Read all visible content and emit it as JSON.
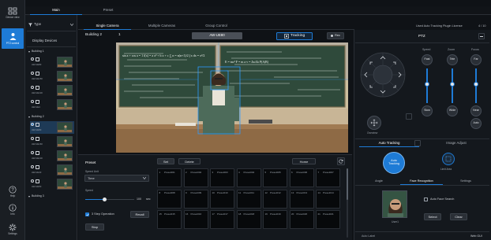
{
  "colors": {
    "accent": "#1e7bd6",
    "bg": "#0f1216",
    "panel": "#14181d",
    "panel2": "#1b2027",
    "text": "#cfd3d9"
  },
  "left_rail": {
    "items": [
      {
        "label": "Device view",
        "icon": "camera-list-icon"
      },
      {
        "label": "PTZ control",
        "icon": "person-tracking-icon",
        "active": true
      }
    ],
    "bottom": [
      {
        "label": "Help",
        "icon": "help-icon"
      },
      {
        "label": "Info",
        "icon": "info-icon"
      },
      {
        "label": "Settings",
        "icon": "gear-icon"
      }
    ]
  },
  "top_tabs": {
    "main": "Main",
    "preset": "Preset"
  },
  "filter": {
    "label": "Type"
  },
  "display_devices": {
    "title": "Display Devices",
    "groups": [
      {
        "name": "Building 1",
        "devices": [
          {
            "name": "AW-UE80"
          },
          {
            "name": "AW-UE150"
          },
          {
            "name": "AW-UE100"
          },
          {
            "name": "AW-UE4"
          }
        ]
      },
      {
        "name": "Building 2",
        "devices": [
          {
            "name": "AW-UE80",
            "selected": true
          },
          {
            "name": "AW-UE160"
          },
          {
            "name": "AW-UE100"
          },
          {
            "name": "AW-UE40"
          },
          {
            "name": "AW-UE50"
          }
        ]
      },
      {
        "name": "Building 3",
        "devices": []
      }
    ]
  },
  "view_tabs": {
    "single": "Single Camera",
    "multiple": "Multiple Cameras",
    "group": "Group Control"
  },
  "camera_bar": {
    "building": "Building 2",
    "index": "1",
    "model": "AW-UE80",
    "tracking": "Tracking",
    "rec": "Rec"
  },
  "license": {
    "text": "Used Auto Tracking Plugin License",
    "count": "4 / 10"
  },
  "preset": {
    "title": "Preset",
    "speed_label": "Speed Unit",
    "speed_value": "Time",
    "speed_sub": "Speed",
    "speed_value_num": "100",
    "speed_unit": "sec",
    "checkbox_label": "3 Step Operation",
    "recall": "Recall",
    "stop": "Stop",
    "set": "Set",
    "delete": "Delete",
    "home": "Home",
    "cells": [
      "Preset001",
      "Preset002",
      "Preset003",
      "Preset004",
      "Preset005",
      "Preset006",
      "Preset007",
      "Preset008",
      "Preset009",
      "Preset010",
      "Preset011",
      "Preset012",
      "Preset013",
      "Preset014",
      "Preset015",
      "Preset016",
      "Preset017",
      "Preset018",
      "Preset019",
      "Preset020",
      "Preset021"
    ],
    "cell_nums": [
      "1",
      "2",
      "3",
      "4",
      "5",
      "6",
      "7",
      "8",
      "9",
      "10",
      "11",
      "12",
      "13",
      "14",
      "15",
      "16",
      "17",
      "18",
      "19",
      "20",
      "21"
    ]
  },
  "ptz": {
    "title": "PTZ",
    "cols": [
      "Speed",
      "Zoom",
      "Focus"
    ],
    "speed_top": "Fast",
    "speed_bottom": "Slow",
    "zoom_top": "Tele",
    "zoom_bottom": "Wide",
    "focus_top": "Far",
    "focus_bottom": "Near",
    "auto": "Auto",
    "overview": "Overview",
    "speed_level": 0.55,
    "zoom_level": 0.55,
    "focus_level": 0.55
  },
  "tracking_panel": {
    "tab_auto": "Auto Tracking",
    "tab_image": "Image Adjust",
    "auto_tracking": "Auto Tracking",
    "limit": "Limit Area",
    "sub_angle": "Angle",
    "sub_face": "Face Recognition",
    "sub_settings": "Settings",
    "auto_face_search": "Auto Face Search",
    "select": "Select",
    "clear": "Clear",
    "face_name": "User1",
    "footer_left": "Auto Label",
    "footer_right": "Web GUI"
  },
  "video": {
    "chalk_left": "sin a + cos a = 1  f(x) = a x² + b x + c  ∑ n = n(n+1)/2  ∫ x dx = x²/2",
    "chalk_right": "E = mc²  F = m a  v = Δx/Δt  P(A|B)"
  }
}
